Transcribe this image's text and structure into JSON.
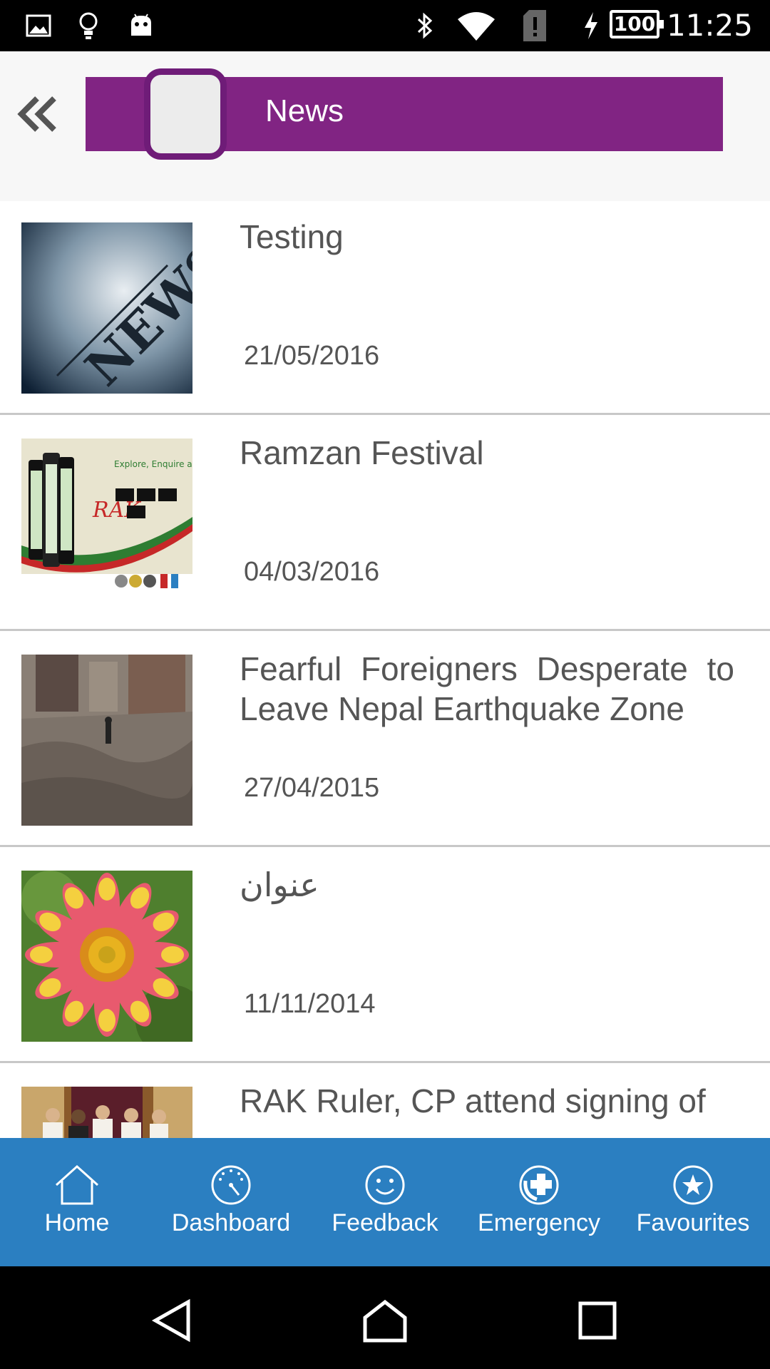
{
  "status_bar": {
    "time": "11:25",
    "battery": "100",
    "icons": [
      "image-icon",
      "lightbulb-icon",
      "android-icon",
      "bluetooth-icon",
      "wifi-icon",
      "sim-alert-icon",
      "charging-icon"
    ]
  },
  "header": {
    "back_icon": "double-chevron-left-icon",
    "title": "News",
    "title_bar_color": "#812483"
  },
  "news": [
    {
      "title": "Testing",
      "date": "21/05/2016",
      "thumb": "news-paper-image"
    },
    {
      "title": "Ramzan Festival",
      "date": "04/03/2016",
      "thumb": "app-banner-image"
    },
    {
      "title": "Fearful Foreigners Desperate to Leave Nepal Earthquake Zone",
      "date": "27/04/2015",
      "thumb": "earthquake-rubble-image"
    },
    {
      "title": "عنوان",
      "date": "11/11/2014",
      "thumb": "flower-image"
    },
    {
      "title": "RAK Ruler, CP attend signing of",
      "date": "",
      "thumb": "officials-image"
    }
  ],
  "bottom_nav": {
    "background": "#2b7fc1",
    "items": [
      {
        "label": "Home",
        "icon": "home-icon"
      },
      {
        "label": "Dashboard",
        "icon": "dashboard-icon"
      },
      {
        "label": "Feedback",
        "icon": "smiley-icon"
      },
      {
        "label": "Emergency",
        "icon": "emergency-phone-icon"
      },
      {
        "label": "Favourites",
        "icon": "star-icon"
      }
    ]
  },
  "system_nav": [
    "back-triangle-icon",
    "home-circle-icon",
    "recents-square-icon"
  ]
}
